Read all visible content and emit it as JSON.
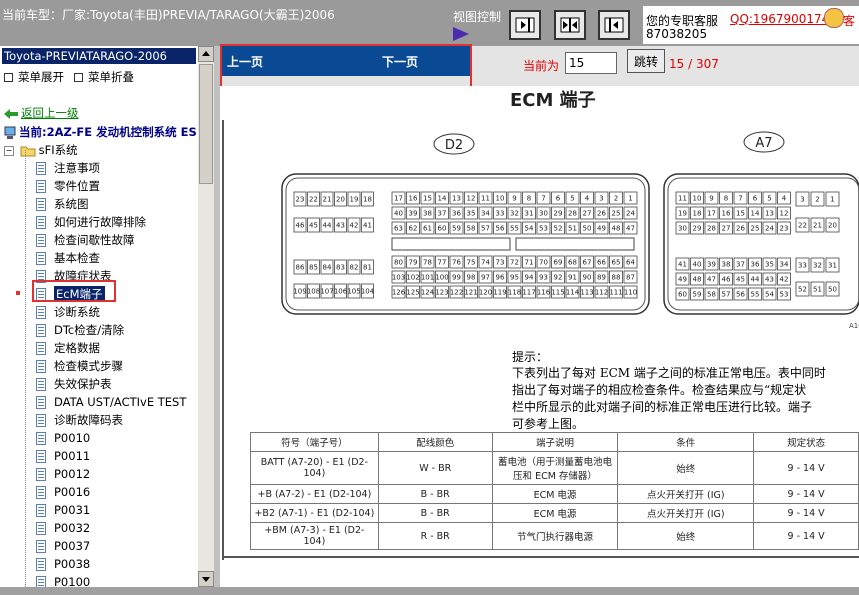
{
  "header": {
    "car_info": "当前车型：厂家:Toyota(丰田)PREVIA/TARAGO(大霸王)2006",
    "view_control": "视图控制",
    "service_label": "您的专职客服",
    "qq": "QQ:1967900174",
    "phone": "87038205",
    "kefu": "客"
  },
  "sidebar": {
    "title": "Toyota-PREVIATARAGO-2006",
    "expand": "菜单展开",
    "collapse": "菜单折叠",
    "back": "返回上一级",
    "current": "当前:2AZ-FE 发动机控制系统 ES",
    "folder": "sFI系统",
    "items": [
      "注意事项",
      "零件位置",
      "系统图",
      "如何进行故障排除",
      "检查间歇性故障",
      "基本检查",
      "故障症状表",
      "EcM端子",
      "诊断系统",
      "DTc检查/清除",
      "定格数据",
      "检查模式步骤",
      "失效保护表",
      "DATA UST/ACTIvE TEST",
      "诊断故障码表",
      "P0010",
      "P0011",
      "P0012",
      "P0016",
      "P0031",
      "P0032",
      "P0037",
      "P0038",
      "P0100"
    ]
  },
  "nav": {
    "prev": "上一页",
    "next": "下一页",
    "current_label": "当前为",
    "page_value": "15",
    "jump": "跳转",
    "page_count": "15 / 307"
  },
  "document": {
    "title": "ECM 端子",
    "connector_left": "D2",
    "connector_right": "A7",
    "figure_code": "A10",
    "note_title": "提示：",
    "note_lines": [
      "下表列出了每对 ECM 端子之间的标准正常电压。表中同时",
      "指出了每对端子的相应检查条件。检查结果应与“规定状",
      "栏中所显示的此对端子间的标准正常电压进行比较。端子",
      "可参考上图。"
    ],
    "table": {
      "headers": [
        "符号（端子号）",
        "配线颜色",
        "端子说明",
        "条件",
        "规定状态"
      ],
      "rows": [
        {
          "symbol": "BATT (A7-20) - E1 (D2-104)",
          "color": "W - BR",
          "desc": "蓄电池（用于测量蓄电池电压和 ECM 存储器）",
          "cond": "始终",
          "spec": "9 - 14 V"
        },
        {
          "symbol": "+B (A7-2) - E1 (D2-104)",
          "color": "B - BR",
          "desc": "ECM 电源",
          "cond": "点火开关打开 (IG)",
          "spec": "9 - 14 V"
        },
        {
          "symbol": "+B2 (A7-1) - E1 (D2-104)",
          "color": "B - BR",
          "desc": "ECM 电源",
          "cond": "点火开关打开 (IG)",
          "spec": "9 - 14 V"
        },
        {
          "symbol": "+BM (A7-3) - E1 (D2-104)",
          "color": "R - BR",
          "desc": "节气门执行器电源",
          "cond": "始终",
          "spec": "9 - 14 V"
        }
      ]
    },
    "pins_d2_left": [
      [
        "23",
        "22",
        "21",
        "20",
        "19",
        "18"
      ],
      [
        "46",
        "45",
        "44",
        "43",
        "42",
        "41"
      ],
      [
        "86",
        "85",
        "84",
        "83",
        "82",
        "81"
      ],
      [
        "109",
        "108",
        "107",
        "106",
        "105",
        "104"
      ]
    ],
    "pins_d2_right": [
      [
        "17",
        "16",
        "15",
        "14",
        "13",
        "12",
        "11",
        "10",
        "9",
        "8",
        "7",
        "6",
        "5",
        "4",
        "3",
        "2",
        "1"
      ],
      [
        "40",
        "39",
        "38",
        "37",
        "36",
        "35",
        "34",
        "33",
        "32",
        "31",
        "30",
        "29",
        "28",
        "27",
        "26",
        "25",
        "24"
      ],
      [
        "63",
        "62",
        "61",
        "60",
        "59",
        "58",
        "57",
        "56",
        "55",
        "54",
        "53",
        "52",
        "51",
        "50",
        "49",
        "48",
        "47"
      ],
      [
        "80",
        "79",
        "78",
        "77",
        "76",
        "75",
        "74",
        "73",
        "72",
        "71",
        "70",
        "69",
        "68",
        "67",
        "66",
        "65",
        "64"
      ],
      [
        "103",
        "102",
        "101",
        "100",
        "99",
        "98",
        "97",
        "96",
        "95",
        "94",
        "93",
        "92",
        "91",
        "90",
        "89",
        "88",
        "87"
      ],
      [
        "126",
        "125",
        "124",
        "123",
        "122",
        "121",
        "120",
        "119",
        "118",
        "117",
        "116",
        "115",
        "114",
        "113",
        "112",
        "111",
        "110"
      ]
    ],
    "pins_a7": [
      [
        "11",
        "10",
        "9",
        "8",
        "7",
        "6",
        "5",
        "4"
      ],
      [
        "19",
        "18",
        "17",
        "16",
        "15",
        "14",
        "13",
        "12"
      ],
      [
        "30",
        "29",
        "28",
        "27",
        "26",
        "25",
        "24",
        "23"
      ],
      [
        "41",
        "40",
        "39",
        "38",
        "37",
        "36",
        "35",
        "34"
      ],
      [
        "49",
        "48",
        "47",
        "46",
        "45",
        "44",
        "43",
        "42"
      ],
      [
        "60",
        "59",
        "58",
        "57",
        "56",
        "55",
        "54",
        "53"
      ]
    ],
    "pins_a7_side": [
      "3",
      "2",
      "1",
      "22",
      "21",
      "20",
      "33",
      "32",
      "31",
      "52",
      "51",
      "50"
    ]
  }
}
